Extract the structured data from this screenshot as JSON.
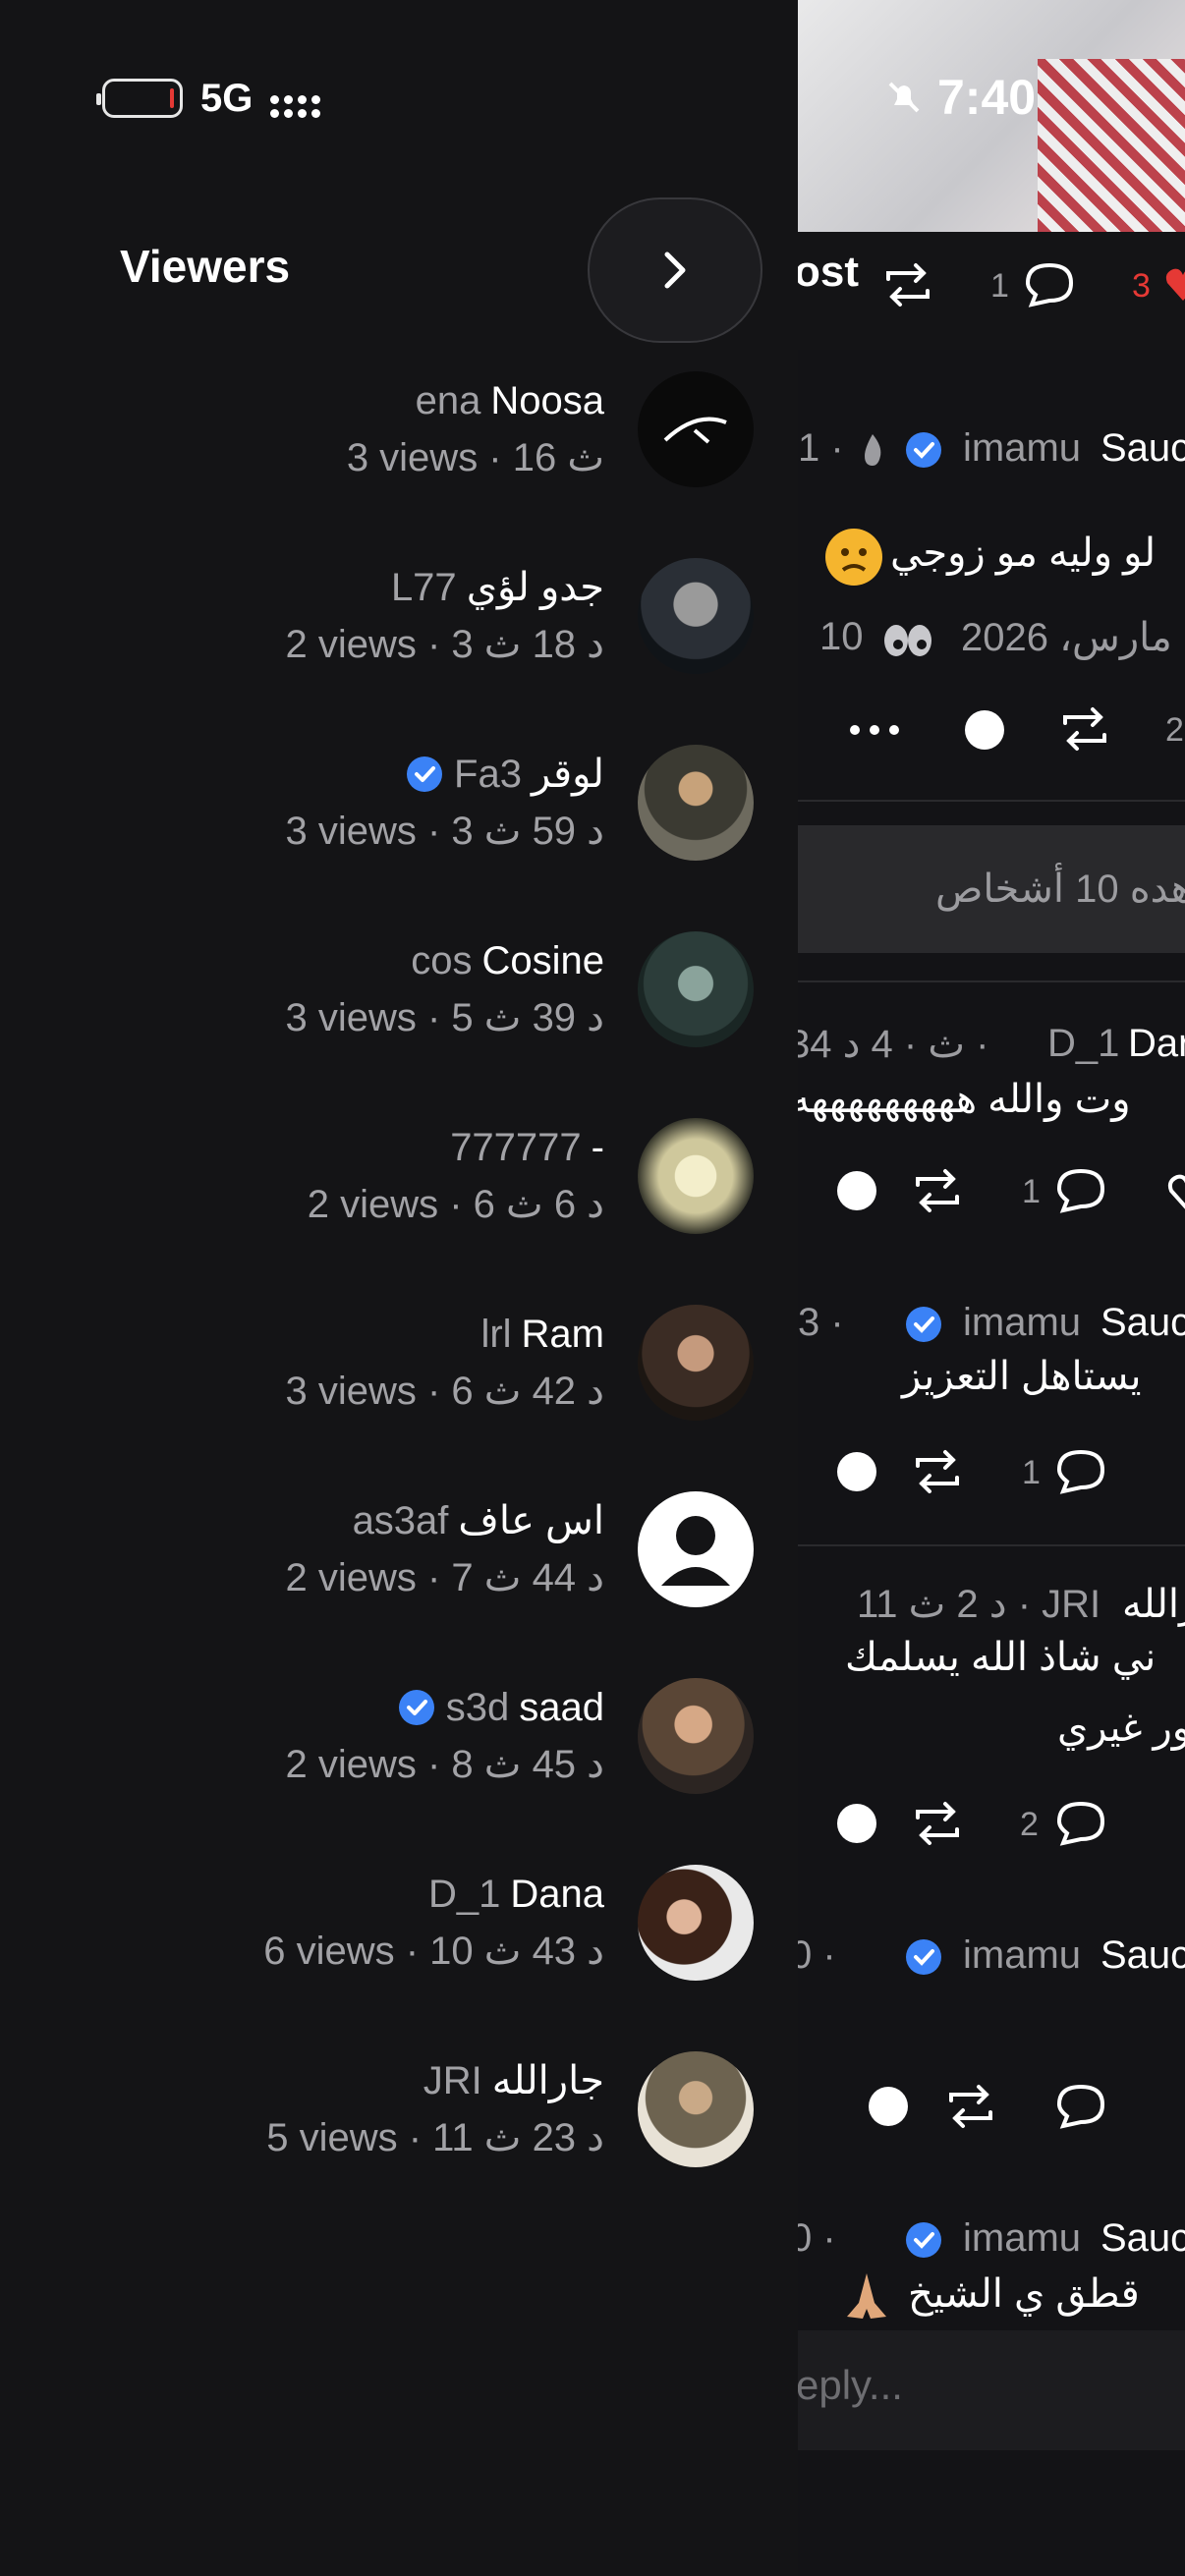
{
  "status_bar": {
    "network": "5G",
    "time": "7:40"
  },
  "header": {
    "title": "Viewers"
  },
  "viewers": [
    {
      "display": "Noosa",
      "handle": "ena",
      "meta": "3 views · 16 ث",
      "verified": false
    },
    {
      "display": "جدو لؤي",
      "handle": "L77",
      "meta": "2 views · 3 د 18 ث",
      "verified": false
    },
    {
      "display": "لوقر",
      "handle": "Fa3",
      "meta": "3 views · 3 د 59 ث",
      "verified": true
    },
    {
      "display": "Cosine",
      "handle": "cos",
      "meta": "3 views · 5 د 39 ث",
      "verified": false
    },
    {
      "display": "-",
      "handle": "777777",
      "meta": "2 views · 6 د 6 ث",
      "verified": false
    },
    {
      "display": "Ram",
      "handle": "lrl",
      "meta": "3 views · 6 د 42 ث",
      "verified": false
    },
    {
      "display": "اس عاف",
      "handle": "as3af",
      "meta": "2 views · 7 د 44 ث",
      "verified": false
    },
    {
      "display": "saad",
      "handle": "s3d",
      "meta": "2 views · 8 د 45 ث",
      "verified": true
    },
    {
      "display": "Dana",
      "handle": "D_1",
      "meta": "6 views · 10 د 43 ث",
      "verified": false
    },
    {
      "display": "جارالله",
      "handle": "JRI",
      "meta": "5 views · 11 د 23 ث",
      "verified": false
    }
  ],
  "feed": {
    "tab_label": "ost",
    "counts": {
      "comments": "1",
      "likes": "3"
    },
    "post1": {
      "meta": "1 ·",
      "author_handle": "imamu",
      "author_name": "Sauc",
      "text": "لو وليه مو زوجي",
      "date": "مارس، 2026 ·",
      "views": "10",
      "action_count": "2"
    },
    "notice": "هده 10 أشخاص",
    "reply1": {
      "meta": "34 ث · 4 د ·",
      "author_handle": "D_1",
      "author_name": "Dar",
      "text": "وت والله هههههههههه",
      "comments": "1"
    },
    "reply2": {
      "meta": "3 ·",
      "author_handle": "imamu",
      "author_name": "Sauc",
      "text": "يستاهل التعزيز",
      "comments": "1"
    },
    "reply3": {
      "meta": "11 د 2 ث · JRI",
      "author_name": "رالله",
      "text_line1": "ني شاذ الله يسلمك",
      "text_line2": "ور غيري",
      "comments": "2"
    },
    "reply4": {
      "meta": "0 ·",
      "author_handle": "imamu",
      "author_name": "Sauc"
    },
    "reply5": {
      "meta": "0 ·",
      "author_handle": "imamu",
      "author_name": "Sauc",
      "text": "قطق ي الشيخ"
    },
    "reply_placeholder": "eply..."
  },
  "colors": {
    "background": "#141416",
    "text": "#ffffff",
    "muted": "#a2a2a6",
    "verified": "#3b82f6",
    "like": "#e53935"
  }
}
